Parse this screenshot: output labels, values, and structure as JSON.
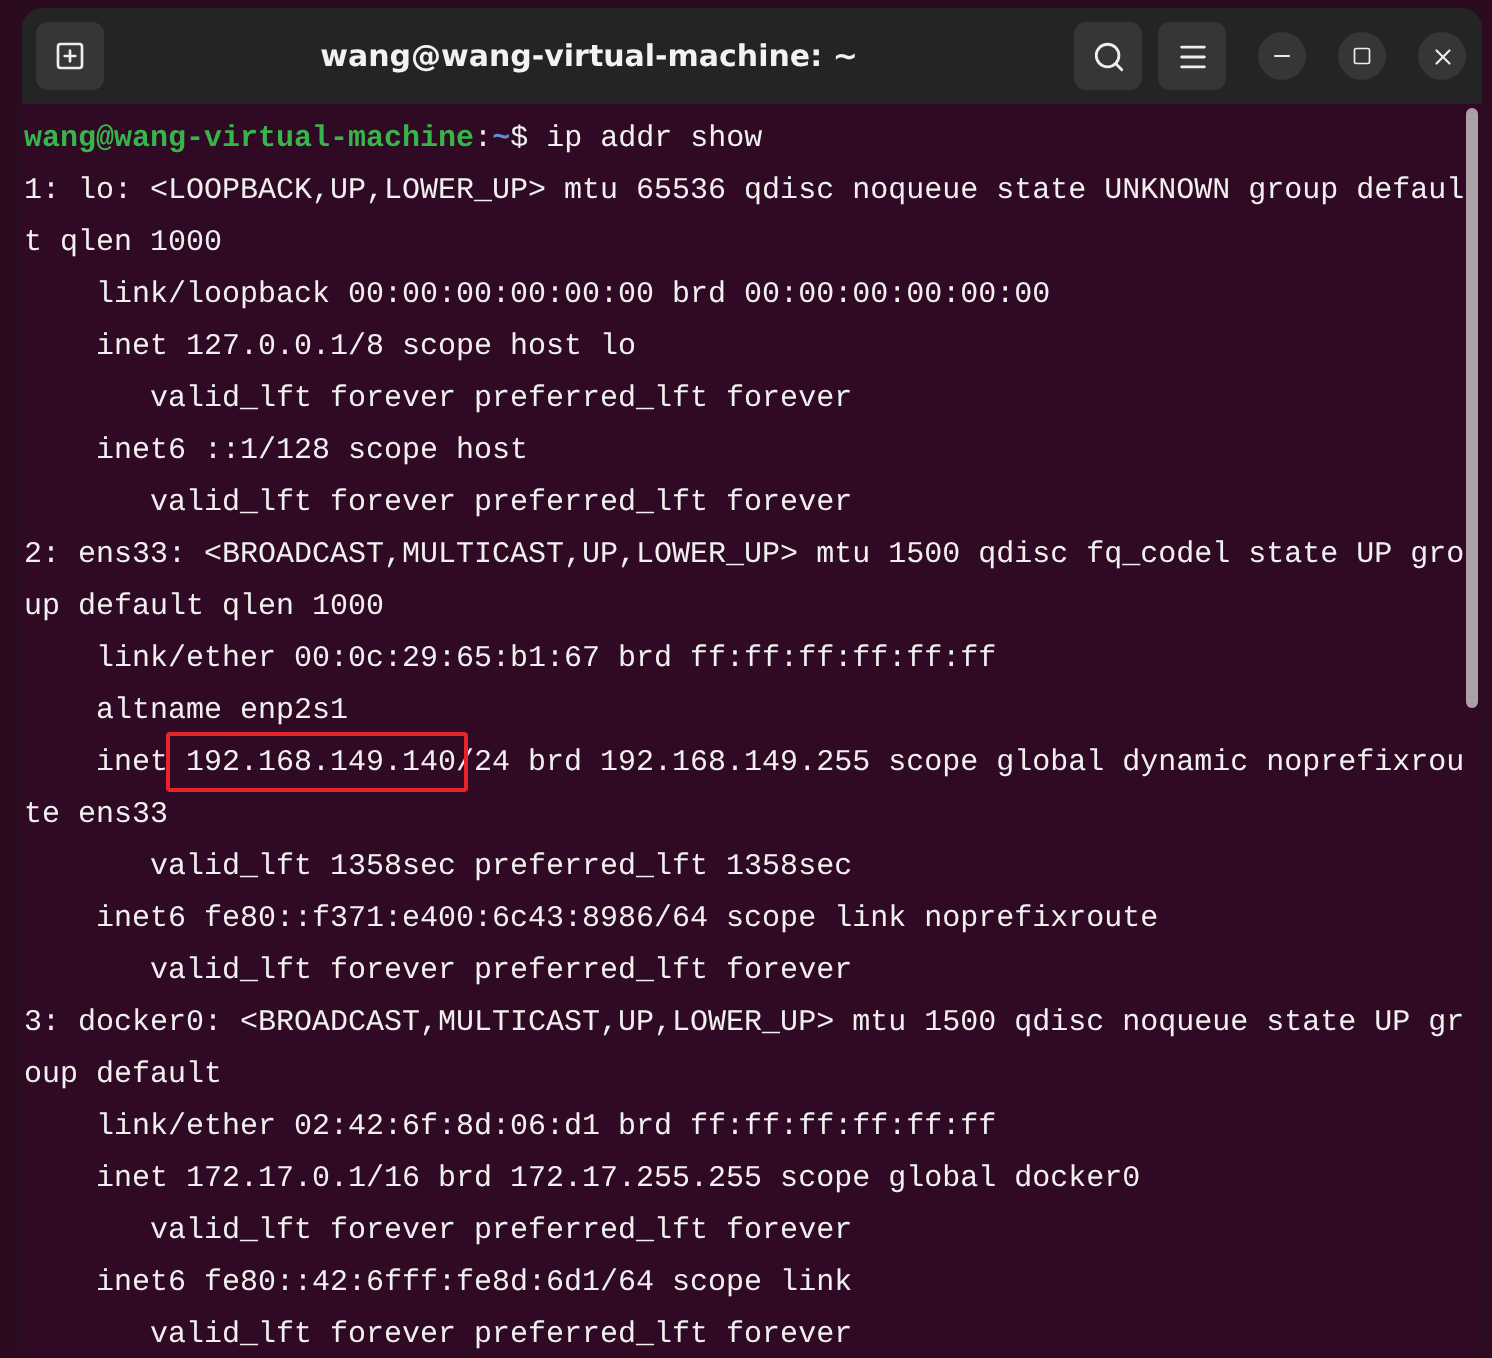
{
  "window": {
    "title": "wang@wang-virtual-machine: ~"
  },
  "prompt": {
    "user_host": "wang@wang-virtual-machine",
    "separator": ":",
    "path": "~",
    "symbol": "$",
    "command": "ip addr show"
  },
  "lines": [
    {
      "text": "1: lo: <LOOPBACK,UP,LOWER_UP> mtu 65536 qdisc noqueue state UNKNOWN group defaul",
      "boxed": false
    },
    {
      "text": "t qlen 1000",
      "boxed": false
    },
    {
      "text": "    link/loopback 00:00:00:00:00:00 brd 00:00:00:00:00:00",
      "boxed": false
    },
    {
      "text": "    inet 127.0.0.1/8 scope host lo",
      "boxed": false
    },
    {
      "text": "       valid_lft forever preferred_lft forever",
      "boxed": false
    },
    {
      "text": "    inet6 ::1/128 scope host",
      "boxed": false
    },
    {
      "text": "       valid_lft forever preferred_lft forever",
      "boxed": false
    },
    {
      "text": "2: ens33: <BROADCAST,MULTICAST,UP,LOWER_UP> mtu 1500 qdisc fq_codel state UP gro",
      "boxed": false
    },
    {
      "text": "up default qlen 1000",
      "boxed": false
    },
    {
      "text": "    link/ether 00:0c:29:65:b1:67 brd ff:ff:ff:ff:ff:ff",
      "boxed": false
    },
    {
      "text": "    altname enp2s1",
      "boxed": false
    },
    {
      "text": "    inet 192.168.149.140/24 brd 192.168.149.255 scope global dynamic noprefixrou",
      "boxed": true
    },
    {
      "text": "te ens33",
      "boxed": false
    },
    {
      "text": "       valid_lft 1358sec preferred_lft 1358sec",
      "boxed": false
    },
    {
      "text": "    inet6 fe80::f371:e400:6c43:8986/64 scope link noprefixroute",
      "boxed": false
    },
    {
      "text": "       valid_lft forever preferred_lft forever",
      "boxed": false
    },
    {
      "text": "3: docker0: <BROADCAST,MULTICAST,UP,LOWER_UP> mtu 1500 qdisc noqueue state UP gr",
      "boxed": false
    },
    {
      "text": "oup default",
      "boxed": false
    },
    {
      "text": "    link/ether 02:42:6f:8d:06:d1 brd ff:ff:ff:ff:ff:ff",
      "boxed": false
    },
    {
      "text": "    inet 172.17.0.1/16 brd 172.17.255.255 scope global docker0",
      "boxed": false
    },
    {
      "text": "       valid_lft forever preferred_lft forever",
      "boxed": false
    },
    {
      "text": "    inet6 fe80::42:6fff:fe8d:6d1/64 scope link",
      "boxed": false
    },
    {
      "text": "       valid_lft forever preferred_lft forever",
      "boxed": false
    }
  ]
}
